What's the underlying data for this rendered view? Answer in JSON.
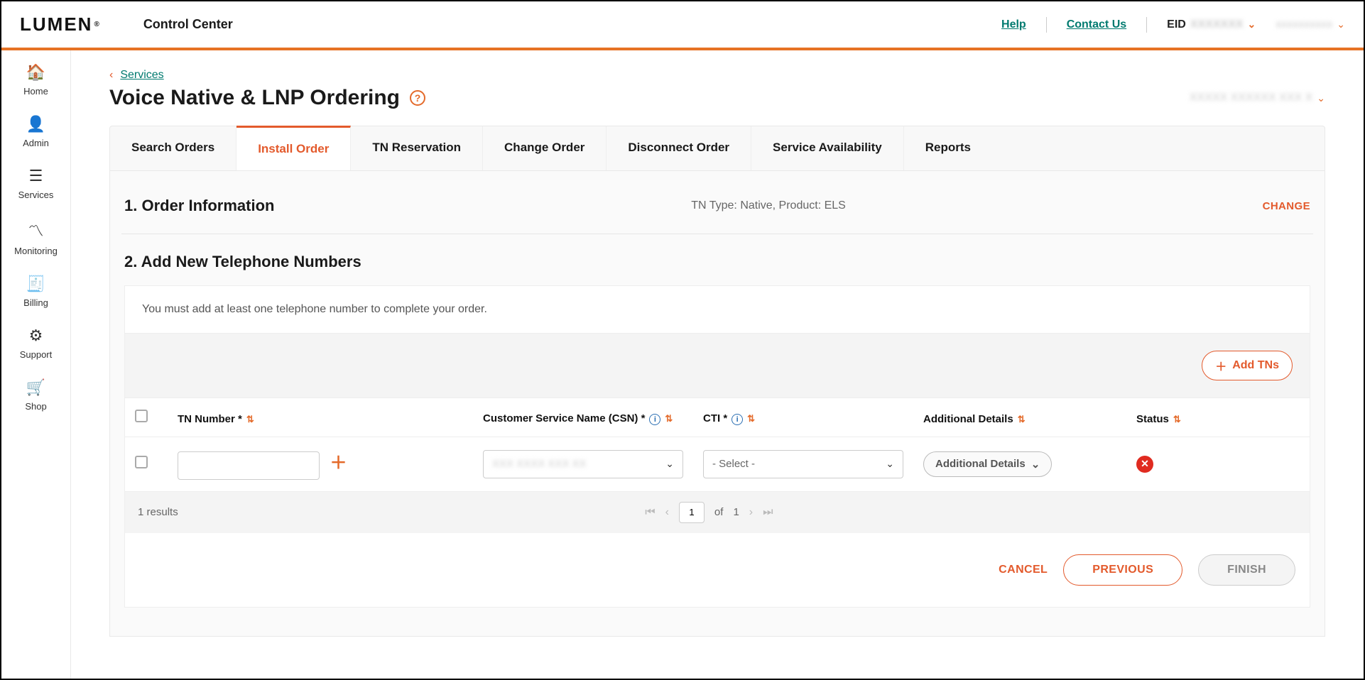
{
  "header": {
    "logo_text": "LUMEN",
    "logo_mark": "®",
    "app_name": "Control Center",
    "help": "Help",
    "contact": "Contact Us",
    "eid_label": "EID",
    "eid_value": "XXXXXXX",
    "account_selector": "xxxxxxxxxx"
  },
  "sidebar": [
    {
      "icon": "🏠",
      "label": "Home"
    },
    {
      "icon": "👤",
      "label": "Admin"
    },
    {
      "icon": "☰",
      "label": "Services"
    },
    {
      "icon": "〽",
      "label": "Monitoring"
    },
    {
      "icon": "🧾",
      "label": "Billing"
    },
    {
      "icon": "⚙",
      "label": "Support"
    },
    {
      "icon": "🛒",
      "label": "Shop"
    }
  ],
  "breadcrumb": {
    "back_icon": "‹",
    "link": "Services"
  },
  "page": {
    "title": "Voice Native & LNP Ordering",
    "account_context": "XXXXX XXXXXX XXX X"
  },
  "tabs": [
    "Search Orders",
    "Install Order",
    "TN Reservation",
    "Change Order",
    "Disconnect Order",
    "Service Availability",
    "Reports"
  ],
  "active_tab": 1,
  "section1": {
    "title": "1. Order Information",
    "meta": "TN Type: Native, Product: ELS",
    "change": "CHANGE"
  },
  "section2": {
    "title": "2. Add New Telephone Numbers",
    "notice": "You must add at least one telephone number to complete your order.",
    "add_btn": "Add TNs",
    "columns": {
      "tn": "TN Number *",
      "csn": "Customer Service Name (CSN) *",
      "cti": "CTI *",
      "add": "Additional Details",
      "status": "Status"
    },
    "row": {
      "tn_value": "",
      "csn_value": "XXX XXXX XXX XX",
      "cti_placeholder": "- Select -",
      "add_label": "Additional Details"
    },
    "pager": {
      "results": "1 results",
      "page": "1",
      "of_label": "of",
      "total": "1"
    }
  },
  "footer": {
    "cancel": "CANCEL",
    "previous": "PREVIOUS",
    "finish": "FINISH"
  }
}
